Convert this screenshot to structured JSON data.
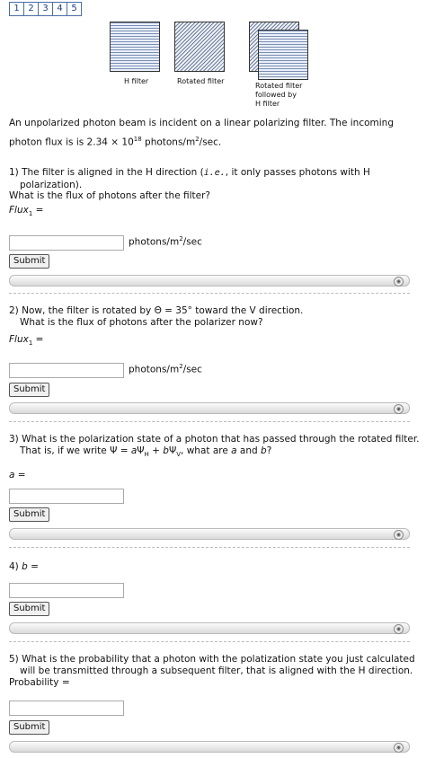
{
  "tabs": [
    "1",
    "2",
    "3",
    "4",
    "5"
  ],
  "figure": {
    "h_label": "H filter",
    "rot_label": "Rotated filter",
    "rot_follow_label_1": "Rotated filter",
    "rot_follow_label_2": "followed by",
    "rot_follow_label_3": "H filter"
  },
  "intro_1": "An unpolarized photon beam is incident on a linear polarizing filter. The incoming",
  "intro_2a": "photon flux is is 2.34 × 10",
  "intro_exp": "18",
  "intro_2b": " photons/m",
  "intro_2c": "/sec.",
  "sq": "2",
  "q1": {
    "line1a": "1) The filter is aligned in the H direction (",
    "ie": "i.e.",
    "line1b": ", it only passes photons with H",
    "line2": "polarization).",
    "line3": "What is the flux of photons after the filter?",
    "var": "Flux",
    "sub": "1",
    "eq": " =",
    "unit_a": "photons/m",
    "unit_b": "/sec",
    "submit": "Submit"
  },
  "q2": {
    "line1": "2) Now, the filter is rotated by Θ = 35° toward the V direction.",
    "line2": "What is the flux of photons after the polarizer now?",
    "var": "Flux",
    "sub": "1",
    "eq": " =",
    "unit_a": "photons/m",
    "unit_b": "/sec",
    "submit": "Submit"
  },
  "q3": {
    "line1": "3) What is the polarization state of a photon that has passed through the rotated filter.",
    "line2a": "That is, if we write Ψ = ",
    "a": "a",
    "psiH": "Ψ",
    "H": "H",
    "plus": " + ",
    "b": "b",
    "psiV": "Ψ",
    "V": "V",
    "line2b": ", what are ",
    "a2": "a",
    "and": " and ",
    "b2": "b",
    "q": "?",
    "ans_var": "a",
    "eq": " =",
    "submit": "Submit"
  },
  "q4": {
    "pre": "4) ",
    "var": "b",
    "eq": " =",
    "submit": "Submit"
  },
  "q5": {
    "line1": "5) What is the probability that a photon with the polatization state you just calculated",
    "line2": "will be transmitted through a subsequent filter, that is aligned with the H direction.",
    "line3": "Probability =",
    "submit": "Submit"
  }
}
